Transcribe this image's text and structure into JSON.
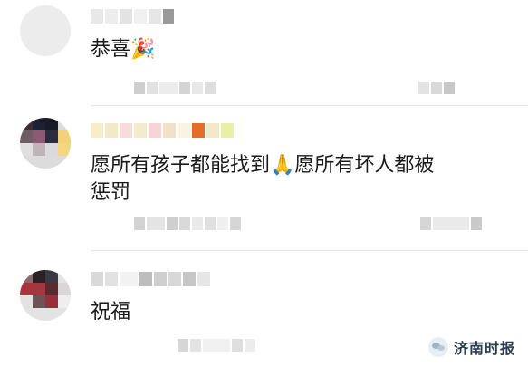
{
  "comments": [
    {
      "text": "恭喜",
      "emoji": "🎉"
    },
    {
      "text_line1_a": "愿所有孩子都能找到",
      "emoji": "🙏",
      "text_line1_b": "愿所有坏人都被",
      "text_line2": "惩罚"
    },
    {
      "text": "祝福"
    }
  ],
  "watermark": {
    "label": "济南时报"
  },
  "colors": {
    "text": "#1a1a1a",
    "divider": "#e6e6e6",
    "blur": "#d6d6d6"
  }
}
